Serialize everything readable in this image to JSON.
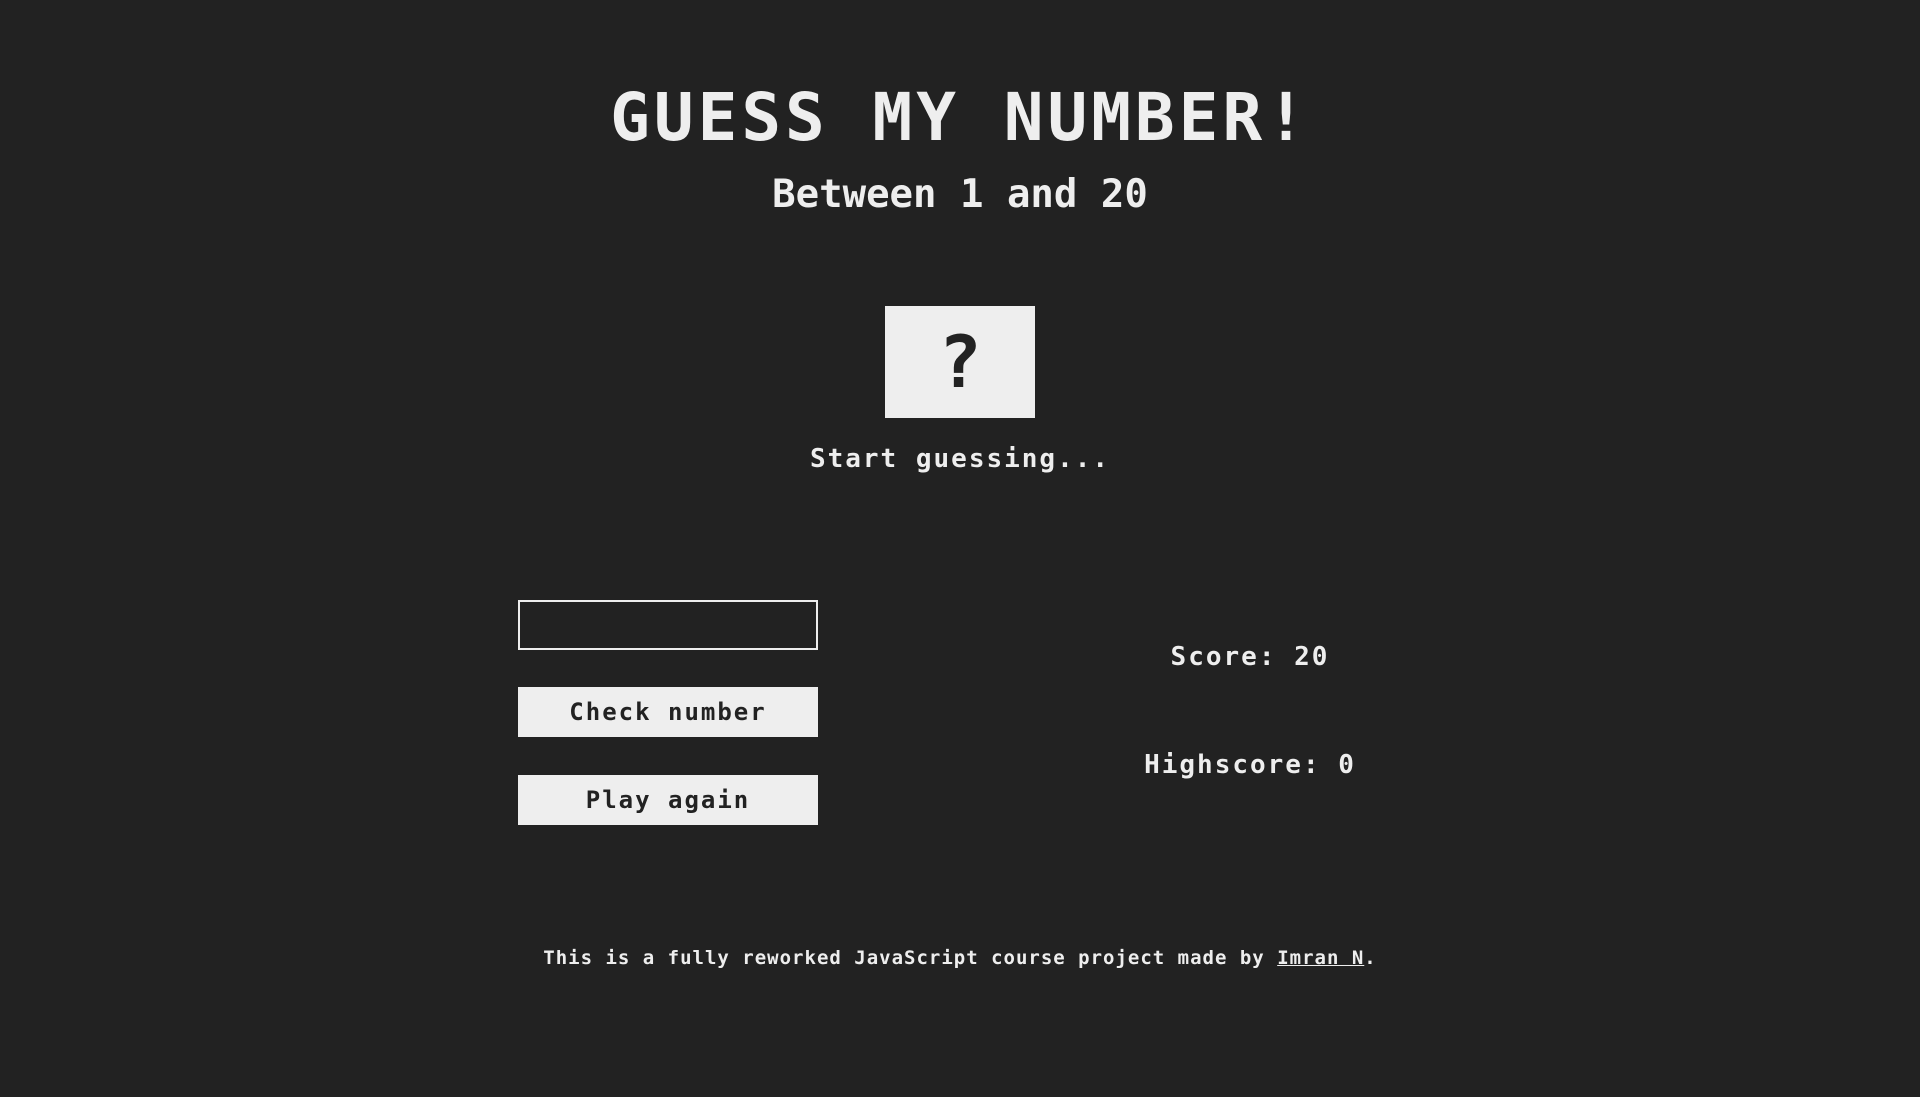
{
  "header": {
    "title": "GUESS MY NUMBER!",
    "subtitle": "Between 1 and 20"
  },
  "secret_box": {
    "symbol": "?"
  },
  "message": "Start guessing...",
  "guess_input": {
    "value": "",
    "placeholder": ""
  },
  "buttons": {
    "check_label": "Check number",
    "again_label": "Play again"
  },
  "score": {
    "label": "Score: 20"
  },
  "highscore": {
    "label": "Highscore: 0"
  },
  "footer": {
    "text": "This is a fully reworked JavaScript course project made by ",
    "author_link": "Imran N",
    "suffix": "."
  },
  "colors": {
    "background": "#222222",
    "foreground": "#eeeeee"
  }
}
